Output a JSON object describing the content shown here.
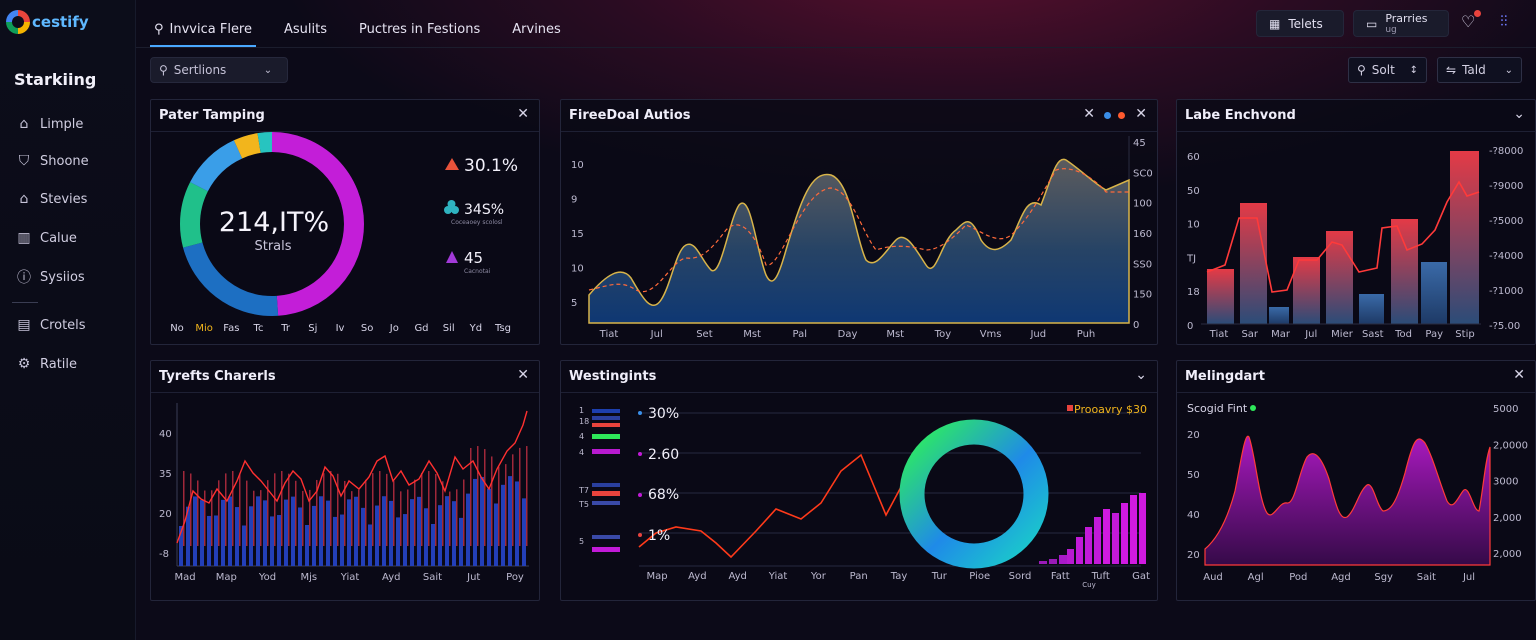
{
  "app": {
    "name": "cestify"
  },
  "sidebar": {
    "title": "Starkiing",
    "items": [
      {
        "label": "Limple",
        "icon": "home-icon"
      },
      {
        "label": "Shoone",
        "icon": "bag-icon"
      },
      {
        "label": "Stevies",
        "icon": "house-icon"
      },
      {
        "label": "Calue",
        "icon": "bar-chart-icon"
      },
      {
        "label": "Sysiios",
        "icon": "info-icon"
      },
      {
        "label": "Crotels",
        "icon": "document-icon"
      },
      {
        "label": "Ratile",
        "icon": "settings-icon"
      }
    ]
  },
  "topnav": {
    "tabs": [
      {
        "label": "Invvica Flere",
        "active": true
      },
      {
        "label": "Asulits"
      },
      {
        "label": "Puctres in Festions"
      },
      {
        "label": "Arvines"
      }
    ]
  },
  "header": {
    "btn_primary": "Telets",
    "btn_secondary": "Prarries",
    "btn_secondary_sub": "ug"
  },
  "filters": {
    "search_value": "Sertlions",
    "right_search": "Solt",
    "right_select": "Tald"
  },
  "panels": {
    "donut": {
      "title": "Pater Tamping",
      "center_value": "214,IT%",
      "center_label": "Strals",
      "stats": [
        {
          "value": "30.1%",
          "sub": "",
          "color": "#e8533b"
        },
        {
          "value": "34S%",
          "sub": "Coceaoey scolosl",
          "color": "#2fb3c0"
        },
        {
          "value": "45",
          "sub": "Cacnotai",
          "color": "#a23ad8"
        }
      ],
      "axis": [
        "No",
        "Mio",
        "Fas",
        "Tc",
        "Tr",
        "Sj",
        "Iv",
        "So",
        "Jo",
        "Gd",
        "Sil",
        "Yd",
        "Tsg"
      ],
      "axis_highlight": 1
    },
    "area": {
      "title": "FireeDoal Autios",
      "y_left": [
        "10",
        "9",
        "15",
        "10",
        "5"
      ],
      "y_right": [
        "45",
        "SC0",
        "100",
        "160",
        "SS0",
        "150",
        "0"
      ],
      "x": [
        "Tiat",
        "Jul",
        "Set",
        "Mst",
        "Pal",
        "Day",
        "Mst",
        "Toy",
        "Vms",
        "Jud",
        "Puh"
      ]
    },
    "bars_top": {
      "title": "Labe Enchvond",
      "y_left": [
        "60",
        "50",
        "10",
        "TJ",
        "18",
        "0"
      ],
      "y_right": [
        "-?8000",
        "-?9000",
        "-?5000",
        "-?4000",
        "-?1000",
        "-?5.00"
      ],
      "x": [
        "Tiat",
        "Sar",
        "Mar",
        "Jul",
        "Mier",
        "Sast",
        "Tod",
        "Pay",
        "Stip"
      ]
    },
    "charts": {
      "title": "Tyrefts Charerls",
      "y": [
        "40",
        "35",
        "20",
        "-8"
      ],
      "x": [
        "Mad",
        "Map",
        "Yod",
        "Mjs",
        "Yiat",
        "Ayd",
        "Sait",
        "Jut",
        "Poy"
      ]
    },
    "westing": {
      "title": "Westingints",
      "left_ticks": [
        "1",
        "18",
        "4",
        "4",
        "T7",
        "T5",
        "5"
      ],
      "stats": [
        "30%",
        "2.60",
        "68%",
        "1%"
      ],
      "legend": "Prooavry $30",
      "x": [
        "Map",
        "Ayd",
        "Ayd",
        "Yiat",
        "Yor",
        "Pan",
        "Tay",
        "Tur",
        "Pioe",
        "Sord",
        "Fatt",
        "Tuft",
        "Gat"
      ],
      "x_sub": "Cuy"
    },
    "meling": {
      "title": "Melingdart",
      "subtitle": "Scogid Fint",
      "y_left": [
        "20",
        "50",
        "40",
        "20"
      ],
      "y_right": [
        "5000",
        "2,0000",
        "3000",
        "2,000",
        "2,000"
      ],
      "x": [
        "Aud",
        "Agl",
        "Pod",
        "Agd",
        "Sgy",
        "Sait",
        "Jul"
      ]
    }
  },
  "colors": {
    "accent": "#4aa8ff",
    "magenta": "#c21ad8",
    "red": "#e8433d",
    "green": "#2ee85a",
    "bg": "#0b0a16"
  }
}
